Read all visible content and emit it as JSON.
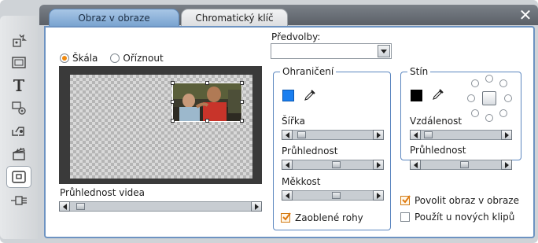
{
  "window": {
    "close_symbol": "✕"
  },
  "tabs": [
    {
      "label": "Obraz v obraze",
      "active": true
    },
    {
      "label": "Chromatický klíč",
      "active": false
    }
  ],
  "toolbar_icons": [
    "video-effects-icon",
    "title-icon",
    "text-icon",
    "sound-effects-icon",
    "transitions-icon",
    "clapperboard-icon",
    "picture-in-picture-icon",
    "audio-icon"
  ],
  "mode": {
    "options": [
      "Škála",
      "Oříznout"
    ],
    "selected": "Škála"
  },
  "preview": {
    "opacity_label": "Průhlednost videa",
    "opacity_value": 0.03
  },
  "presets": {
    "label": "Předvolby:",
    "value": ""
  },
  "border": {
    "title": "Ohraničení",
    "color": "#1a7ff0",
    "width_label": "Šířka",
    "width_value": 0.06,
    "opacity_label": "Průhlednost",
    "opacity_value": 0.55,
    "softness_label": "Měkkost",
    "softness_value": 0.55,
    "rounded_label": "Zaoblené rohy",
    "rounded_checked": true
  },
  "shadow": {
    "title": "Stín",
    "color": "#000000",
    "distance_label": "Vzdálenost",
    "distance_value": 0.03,
    "opacity_label": "Průhlednost",
    "opacity_value": 0.55
  },
  "options": {
    "enable_label": "Povolit obraz v obraze",
    "enable_checked": true,
    "apply_new_label": "Použít u nových klipů",
    "apply_new_checked": false
  },
  "colors": {
    "accent": "#f08a10",
    "panel_border": "#6d93c2",
    "tab_active": "#8fb3db"
  }
}
